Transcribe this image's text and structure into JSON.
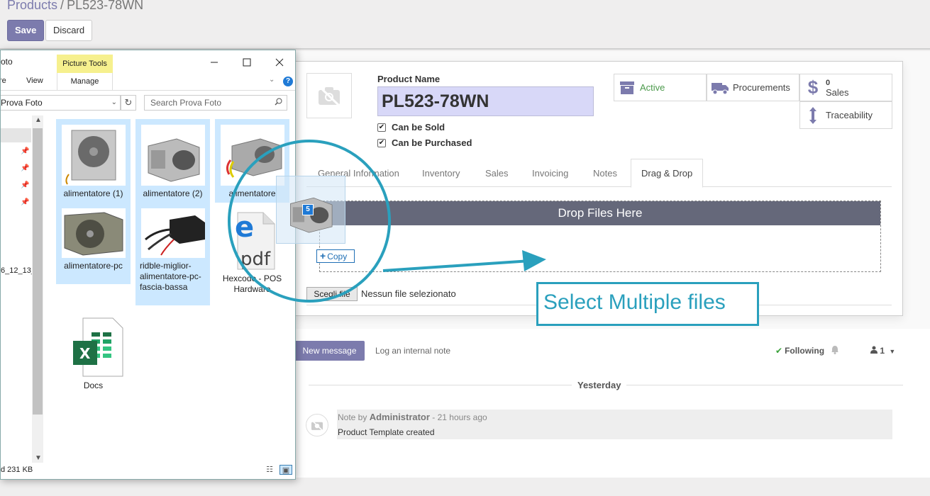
{
  "breadcrumb": {
    "parent": "Products",
    "separator": "/",
    "current": "PL523-78WN"
  },
  "toolbar": {
    "save_label": "Save",
    "discard_label": "Discard"
  },
  "form": {
    "product_name_label": "Product Name",
    "product_name_value": "PL523-78WN",
    "can_be_sold_label": "Can be Sold",
    "can_be_sold_checked": true,
    "can_be_purchased_label": "Can be Purchased",
    "can_be_purchased_checked": true
  },
  "smart_buttons": {
    "active": "Active",
    "procurements": "Procurements",
    "sales_count": "0",
    "sales_label": "Sales",
    "traceability": "Traceability"
  },
  "tabs": [
    "General Information",
    "Inventory",
    "Sales",
    "Invoicing",
    "Notes",
    "Drag & Drop"
  ],
  "active_tab": "Drag & Drop",
  "dropzone": {
    "header": "Drop Files Here"
  },
  "file_input": {
    "button_label": "Scegli file",
    "status": "Nessun file selezionato"
  },
  "chatter": {
    "new_message": "New message",
    "log_note": "Log an internal note",
    "following": "Following",
    "followers_count": "1",
    "date_separator": "Yesterday",
    "message": {
      "prefix": "Note by",
      "author": "Administrator",
      "time": "- 21 hours ago",
      "body": "Product Template created"
    }
  },
  "annotation": "Select Multiple files",
  "explorer": {
    "title": "oto",
    "picture_tools": "Picture Tools",
    "ribbon_tabs": {
      "share_fragment": "re",
      "view": "View",
      "manage": "Manage"
    },
    "address": "Prova Foto",
    "search_placeholder": "Search Prova Foto",
    "nav_fragment": "6_12_13_",
    "status_fragment": "d  231 KB",
    "files": [
      {
        "name": "alimentatore (1)",
        "selected": true,
        "type": "psu"
      },
      {
        "name": "alimentatore (2)",
        "selected": true,
        "type": "psu"
      },
      {
        "name": "alimentatore",
        "selected": true,
        "type": "psu"
      },
      {
        "name": "alimentatore-pc",
        "selected": true,
        "type": "psu"
      },
      {
        "name": "ridble-miglior-alimentatore-pc-fascia-bassa",
        "selected": true,
        "type": "psu"
      },
      {
        "name": "Hexcode - POS Hardware",
        "selected": false,
        "type": "pdf"
      },
      {
        "name": "Docs",
        "selected": false,
        "type": "xlsx"
      }
    ]
  },
  "drag": {
    "count": "5",
    "action": "Copy"
  },
  "colors": {
    "accent": "#7c7bad",
    "annotation": "#2aa0bd",
    "selection": "#cce8ff",
    "dropzone_header": "#65687a"
  }
}
